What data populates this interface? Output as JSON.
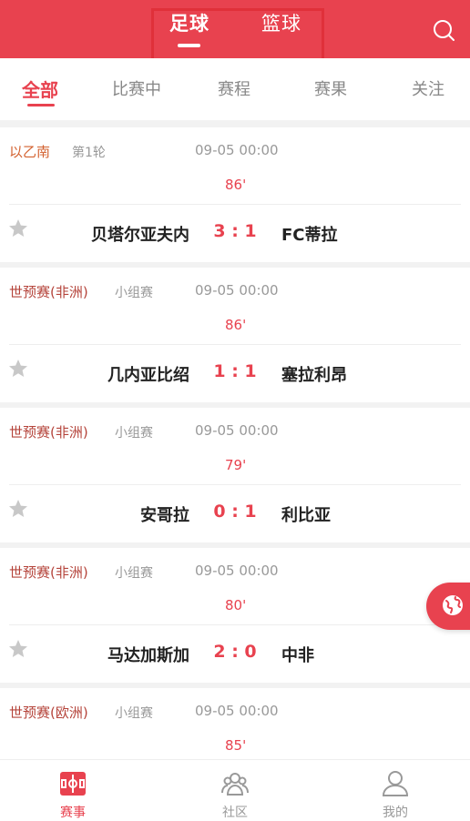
{
  "header": {
    "sport_tabs": [
      "足球",
      "篮球"
    ],
    "active_sport": "足球"
  },
  "filters": [
    "全部",
    "比赛中",
    "赛程",
    "赛果",
    "关注"
  ],
  "matches": [
    {
      "league": "以乙南",
      "round": "第1轮",
      "time": "09-05 00:00",
      "minute": "86'",
      "home": "贝塔尔亚夫内",
      "score": "3 : 1",
      "away": "FC蒂拉"
    },
    {
      "league": "世预赛(非洲)",
      "round": "小组赛",
      "time": "09-05 00:00",
      "minute": "86'",
      "home": "几内亚比绍",
      "score": "1 : 1",
      "away": "塞拉利昂"
    },
    {
      "league": "世预赛(非洲)",
      "round": "小组赛",
      "time": "09-05 00:00",
      "minute": "79'",
      "home": "安哥拉",
      "score": "0 : 1",
      "away": "利比亚"
    },
    {
      "league": "世预赛(非洲)",
      "round": "小组赛",
      "time": "09-05 00:00",
      "minute": "80'",
      "home": "马达加斯加",
      "score": "2 : 0",
      "away": "中非"
    },
    {
      "league": "世预赛(欧洲)",
      "round": "小组赛",
      "time": "09-05 00:00",
      "minute": "85'",
      "home": "",
      "score": "",
      "away": ""
    }
  ],
  "bottom_nav": [
    {
      "label": "赛事",
      "icon": "match-icon"
    },
    {
      "label": "社区",
      "icon": "community-icon"
    },
    {
      "label": "我的",
      "icon": "profile-icon"
    }
  ],
  "colors": {
    "accent": "#e8424f",
    "league": "#b5443b"
  }
}
